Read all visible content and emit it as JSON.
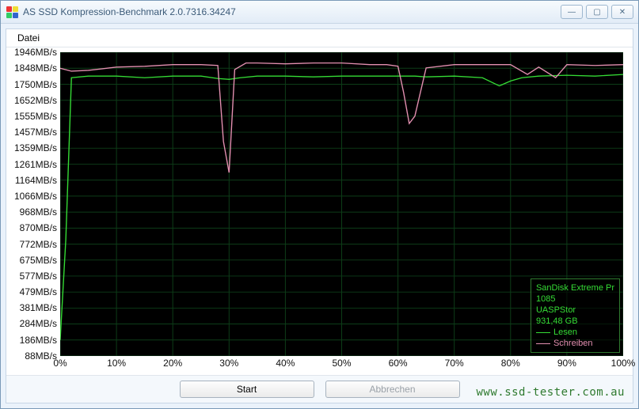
{
  "window": {
    "title": "AS SSD Kompression-Benchmark 2.0.7316.34247"
  },
  "menu": {
    "file": "Datei"
  },
  "buttons": {
    "start": "Start",
    "cancel": "Abbrechen"
  },
  "legend": {
    "device": "SanDisk Extreme Pr",
    "model": "1085",
    "driver": "UASPStor",
    "capacity": "931,48 GB",
    "read": "Lesen",
    "write": "Schreiben"
  },
  "watermark": "www.ssd-tester.com.au",
  "chart_data": {
    "type": "line",
    "title": "AS SSD Kompression-Benchmark",
    "xlabel": "",
    "ylabel": "MB/s",
    "xlim": [
      0,
      100
    ],
    "ylim": [
      88,
      1946
    ],
    "x_ticks": [
      0,
      10,
      20,
      30,
      40,
      50,
      60,
      70,
      80,
      90,
      100
    ],
    "x_tick_labels": [
      "0%",
      "10%",
      "20%",
      "30%",
      "40%",
      "50%",
      "60%",
      "70%",
      "80%",
      "90%",
      "100%"
    ],
    "y_ticks": [
      1946,
      1848,
      1750,
      1652,
      1555,
      1457,
      1359,
      1261,
      1164,
      1066,
      968,
      870,
      772,
      675,
      577,
      479,
      381,
      284,
      186,
      88
    ],
    "y_tick_labels": [
      "1946MB/s",
      "1848MB/s",
      "1750MB/s",
      "1652MB/s",
      "1555MB/s",
      "1457MB/s",
      "1359MB/s",
      "1261MB/s",
      "1164MB/s",
      "1066MB/s",
      "968MB/s",
      "870MB/s",
      "772MB/s",
      "675MB/s",
      "577MB/s",
      "479MB/s",
      "381MB/s",
      "284MB/s",
      "186MB/s",
      "88MB/s"
    ],
    "series": [
      {
        "name": "Lesen",
        "color": "#35dc35",
        "x": [
          0,
          1,
          2,
          5,
          10,
          15,
          20,
          25,
          28,
          30,
          32,
          35,
          40,
          45,
          50,
          55,
          60,
          63,
          65,
          70,
          75,
          78,
          80,
          82,
          85,
          90,
          95,
          100
        ],
        "y": [
          186,
          800,
          1790,
          1800,
          1800,
          1790,
          1800,
          1800,
          1785,
          1780,
          1790,
          1800,
          1800,
          1795,
          1800,
          1800,
          1800,
          1800,
          1795,
          1800,
          1790,
          1740,
          1770,
          1790,
          1800,
          1805,
          1800,
          1810
        ]
      },
      {
        "name": "Schreiben",
        "color": "#e38fb0",
        "x": [
          0,
          2,
          5,
          10,
          15,
          20,
          25,
          28,
          29,
          30,
          31,
          33,
          35,
          40,
          45,
          50,
          55,
          58,
          60,
          61,
          62,
          63,
          65,
          70,
          75,
          80,
          83,
          85,
          88,
          90,
          95,
          100
        ],
        "y": [
          1848,
          1830,
          1835,
          1855,
          1860,
          1870,
          1870,
          1865,
          1400,
          1210,
          1840,
          1880,
          1880,
          1875,
          1880,
          1880,
          1870,
          1870,
          1860,
          1700,
          1510,
          1555,
          1850,
          1870,
          1870,
          1870,
          1810,
          1855,
          1790,
          1870,
          1865,
          1870
        ]
      }
    ]
  }
}
